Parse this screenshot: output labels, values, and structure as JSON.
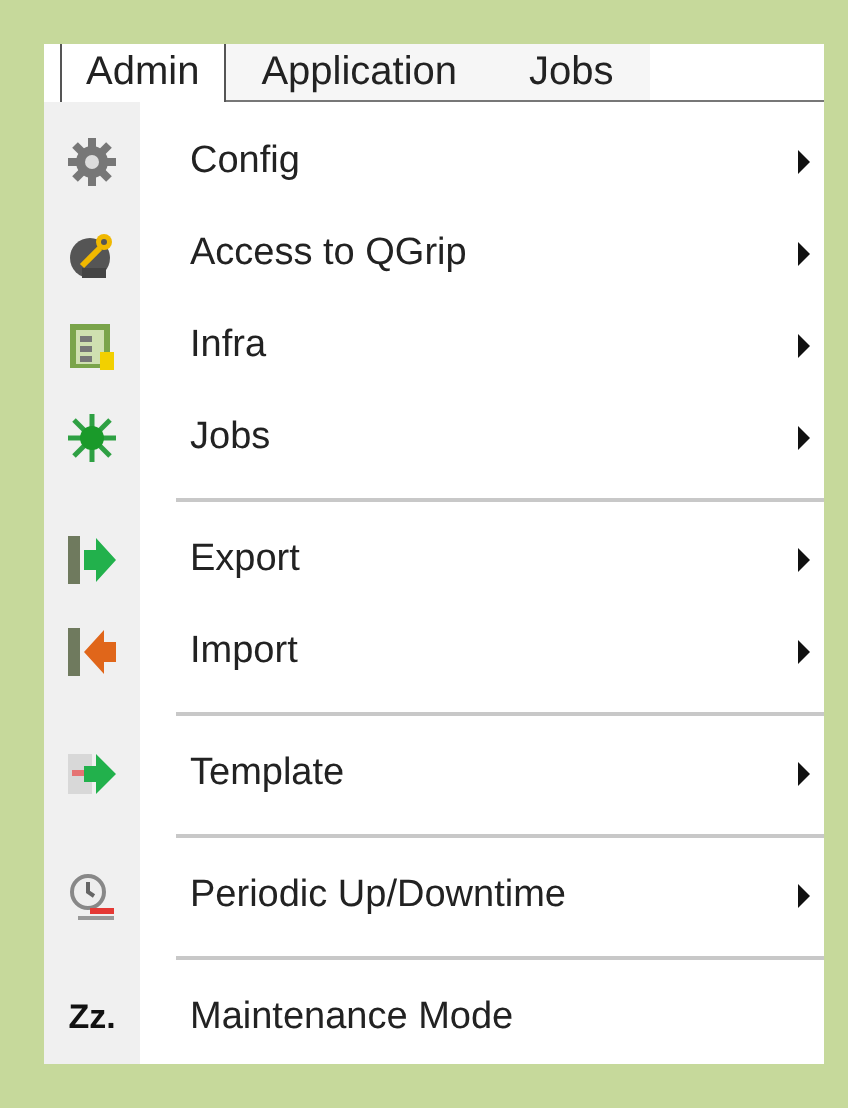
{
  "tabs": [
    {
      "label": "Admin",
      "selected": true
    },
    {
      "label": "Application",
      "selected": false
    },
    {
      "label": "Jobs",
      "selected": false
    }
  ],
  "menu_groups": [
    {
      "items": [
        {
          "label": "Config",
          "submenu": true
        },
        {
          "label": "Access to QGrip",
          "submenu": true
        },
        {
          "label": "Infra",
          "submenu": true
        },
        {
          "label": "Jobs",
          "submenu": true
        }
      ]
    },
    {
      "items": [
        {
          "label": "Export",
          "submenu": true
        },
        {
          "label": "Import",
          "submenu": true
        }
      ]
    },
    {
      "items": [
        {
          "label": "Template",
          "submenu": true
        }
      ]
    },
    {
      "items": [
        {
          "label": "Periodic Up/Downtime",
          "submenu": true
        }
      ]
    },
    {
      "items": [
        {
          "label": "Maintenance Mode",
          "submenu": false,
          "icon_text": "Zz."
        }
      ]
    }
  ]
}
